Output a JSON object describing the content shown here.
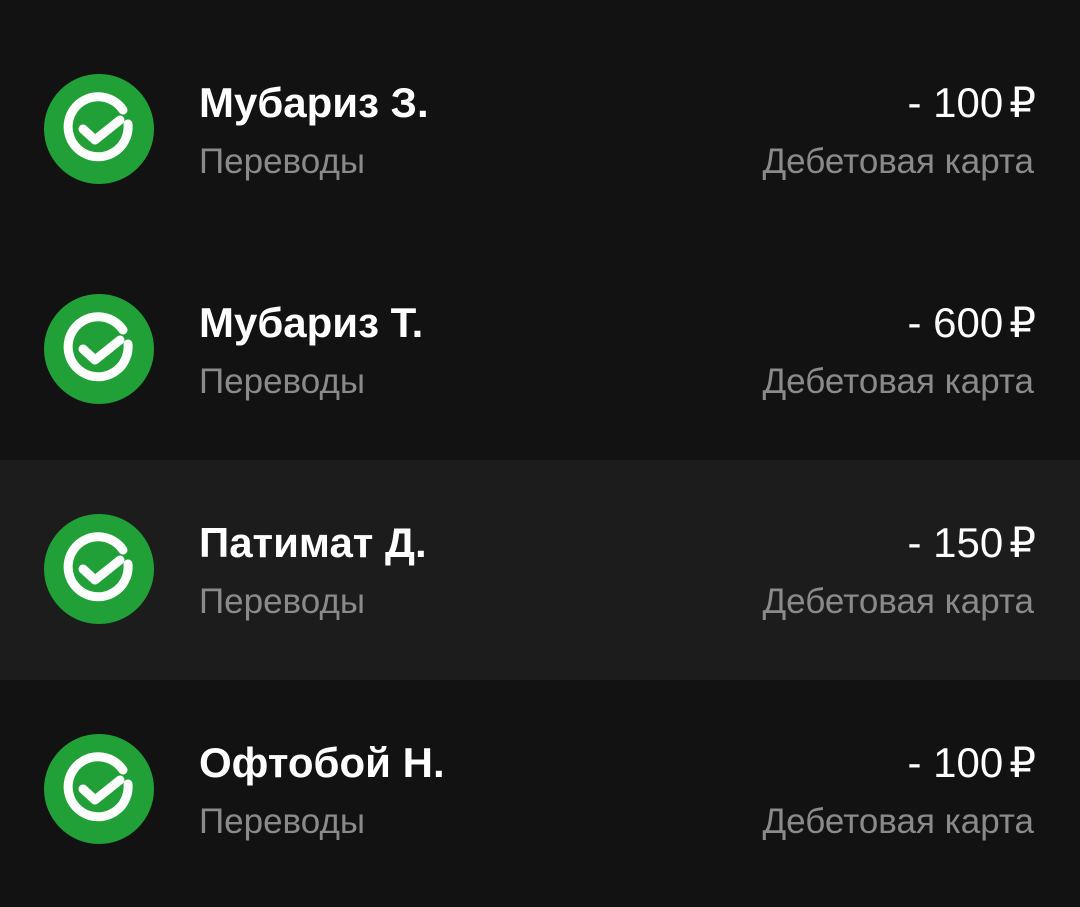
{
  "colors": {
    "background": "#121212",
    "highlight_row": "#1c1c1c",
    "icon_green": "#21a038",
    "primary_text": "#ffffff",
    "secondary_text": "#8a8a8a"
  },
  "icon_name": "sber-check-logo-icon",
  "transactions": [
    {
      "name": "Мубариз З.",
      "category": "Переводы",
      "amount": "- 100",
      "currency": "₽",
      "account": "Дебетовая карта"
    },
    {
      "name": "Мубариз Т.",
      "category": "Переводы",
      "amount": "- 600",
      "currency": "₽",
      "account": "Дебетовая карта"
    },
    {
      "name": "Патимат Д.",
      "category": "Переводы",
      "amount": "- 150",
      "currency": "₽",
      "account": "Дебетовая карта"
    },
    {
      "name": "Офтобой Н.",
      "category": "Переводы",
      "amount": "- 100",
      "currency": "₽",
      "account": "Дебетовая карта"
    }
  ]
}
